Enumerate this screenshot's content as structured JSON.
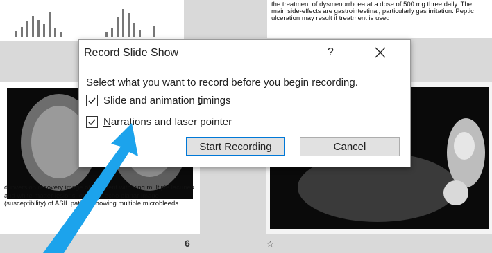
{
  "background": {
    "top_right_text": "the treatment of dysmenorrhoea at a dose of 500 mg three daily. The main side-effects are gastrointestinal, particularly gas irritation. Peptic ulceration may result if treatment is used",
    "caption_text": "d inversion recovery image of a patient with ving multiple lacunes and white matter lesions. gradient echo planar image (susceptibility) of ASIL patient showing multiple microbleeds.",
    "page_number": "6",
    "star_glyph": "☆"
  },
  "dialog": {
    "title": "Record Slide Show",
    "help_label": "?",
    "instruction": "Select what you want to record before you begin recording.",
    "option1": {
      "pre": "Slide and animation ",
      "accel": "t",
      "post": "imings",
      "checked": true
    },
    "option2": {
      "pre": "",
      "accel": "N",
      "post": "arrations and laser pointer",
      "checked": true
    },
    "start_button": {
      "pre": "Start ",
      "accel": "R",
      "post": "ecording"
    },
    "cancel_label": "Cancel"
  },
  "annotation": {
    "arrow_color": "#1ca3ec"
  }
}
